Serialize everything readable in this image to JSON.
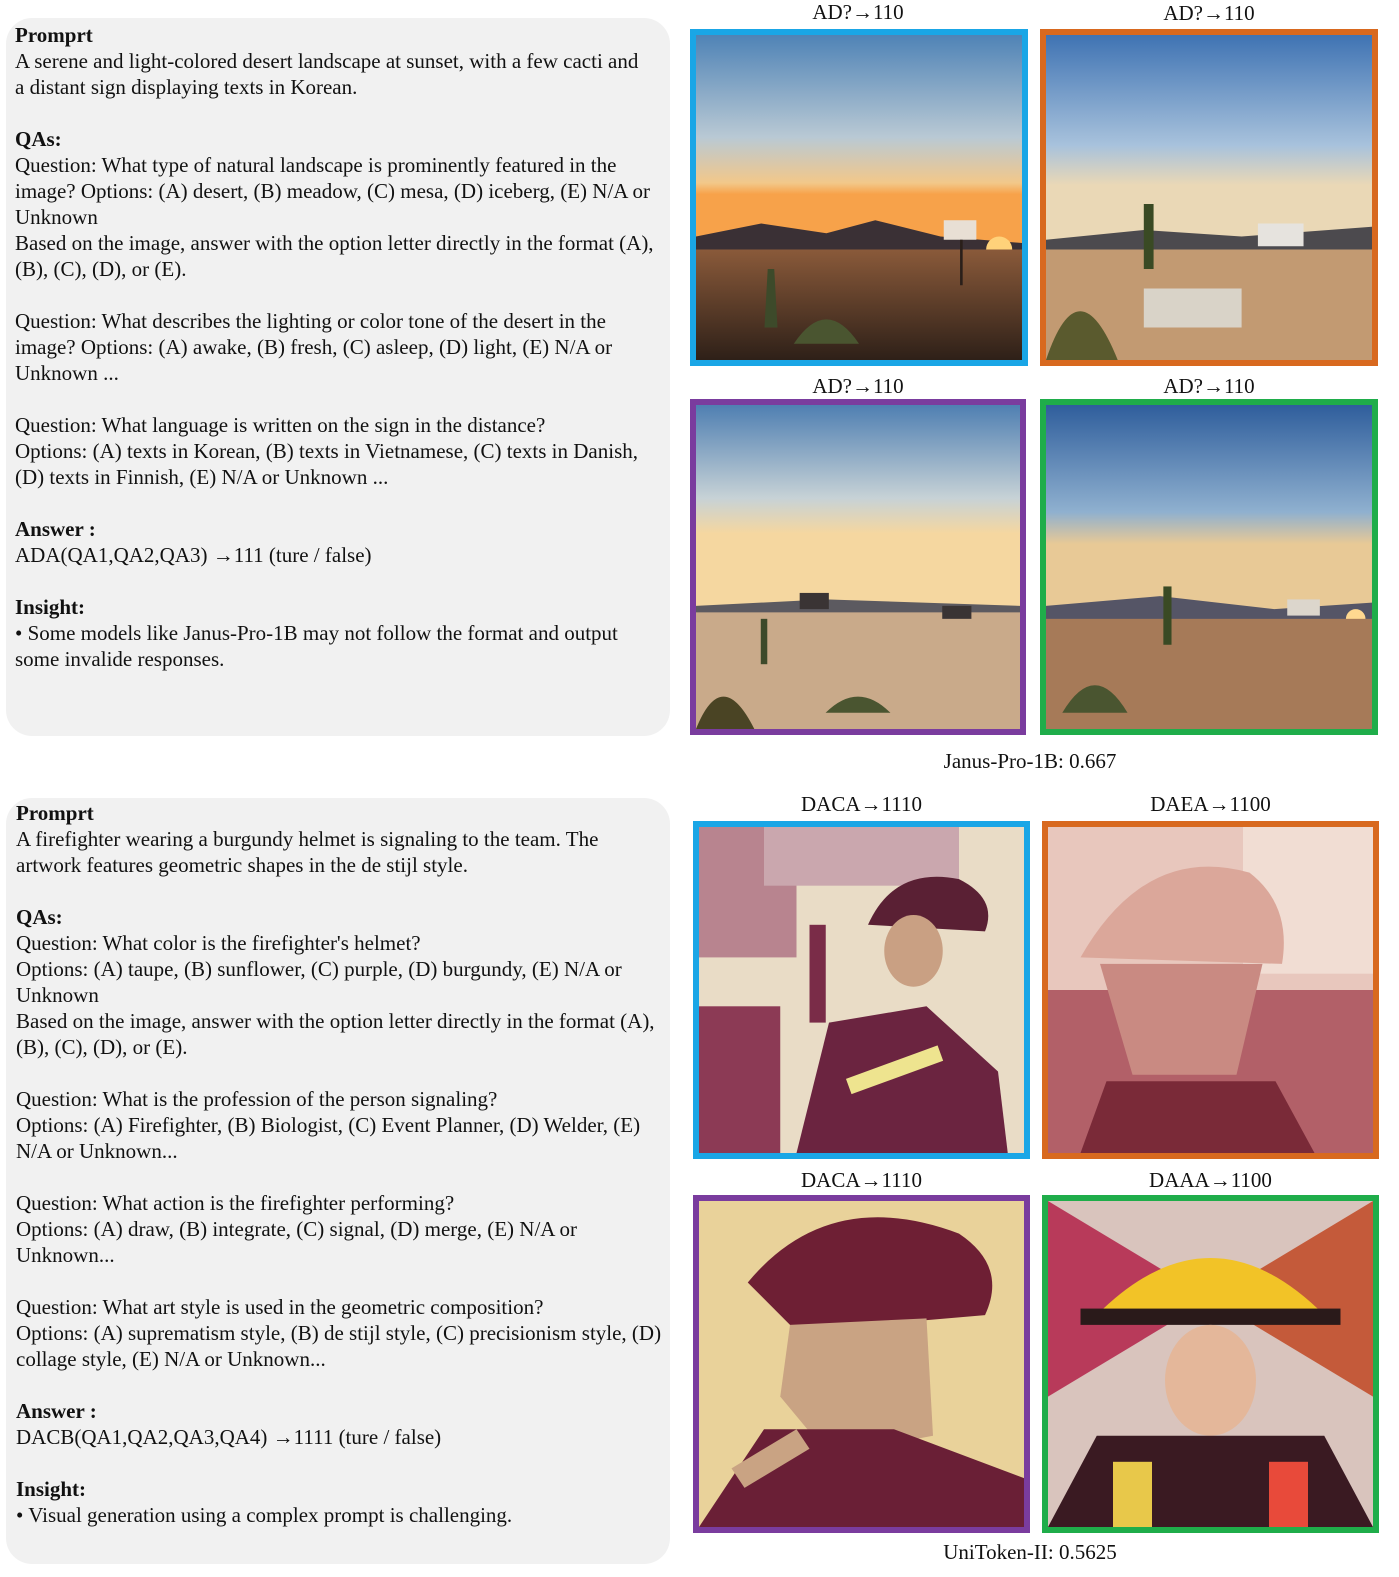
{
  "example1": {
    "prompt_heading": "Promprt",
    "prompt_lines": [
      "A serene and light-colored desert landscape at sunset, with a few cacti and",
      "a distant sign displaying texts in Korean."
    ],
    "qas_heading": "QAs:",
    "qa_lines": [
      "Question: What type of natural landscape is prominently featured in the",
      "image? Options: (A) desert, (B) meadow, (C) mesa, (D) iceberg, (E) N/A or",
      "Unknown",
      "Based on the image, answer with the option letter directly in the format (A),",
      "(B), (C), (D), or (E).",
      "",
      "Question: What describes the lighting or color tone of the desert in the",
      "image? Options: (A) awake, (B) fresh, (C) asleep, (D) light, (E) N/A or",
      "Unknown ...",
      "",
      "Question: What language is written on the sign in the distance?",
      "Options: (A) texts in Korean, (B) texts in Vietnamese, (C) texts in Danish,",
      "(D) texts in Finnish, (E) N/A or Unknown ..."
    ],
    "answer_heading": "Answer :",
    "answer_text": "ADA(QA1,QA2,QA3) →111 (ture / false)",
    "insight_heading": "Insight:",
    "insight_lines": [
      "•  Some models like Janus-Pro-1B may not follow the format and output",
      "some invalide responses."
    ],
    "captions": [
      "AD?→110",
      "AD?→110",
      "AD?→110",
      "AD?→110"
    ],
    "score": "Janus-Pro-1B: 0.667"
  },
  "example2": {
    "prompt_heading": "Promprt",
    "prompt_lines": [
      "A firefighter wearing a burgundy helmet is signaling to the team. The",
      "artwork features geometric shapes in the de stijl style."
    ],
    "qas_heading": "QAs:",
    "qa_lines": [
      "Question: What color is the firefighter's helmet?",
      "Options: (A) taupe, (B) sunflower, (C) purple, (D) burgundy, (E) N/A or",
      "Unknown",
      "Based on the image, answer with the option letter directly in the format (A),",
      "(B), (C), (D), or (E).",
      "",
      "Question: What is the profession of the person signaling?",
      "Options: (A) Firefighter, (B) Biologist, (C) Event Planner, (D) Welder, (E)",
      "N/A or Unknown...",
      "",
      "Question: What action is the firefighter performing?",
      "Options: (A) draw, (B) integrate, (C) signal, (D) merge, (E) N/A or",
      "Unknown...",
      "",
      "Question: What art style is used in the geometric composition?",
      "Options: (A) suprematism style, (B) de stijl style, (C) precisionism style, (D)",
      "collage style, (E) N/A or Unknown..."
    ],
    "answer_heading": "Answer :",
    "answer_text": "DACB(QA1,QA2,QA3,QA4) →1111 (ture / false)",
    "insight_heading": "Insight:",
    "insight_lines": [
      "•  Visual generation using a complex prompt is challenging."
    ],
    "captions": [
      "DACA→1110",
      "DAEA→1100",
      "DACA→1110",
      "DAAA→1100"
    ],
    "score": "UniToken-II: 0.5625"
  },
  "frame_colors": {
    "blue": "#1aa6e6",
    "orange": "#d8691f",
    "purple": "#7a3c9e",
    "green": "#1fad4a"
  }
}
